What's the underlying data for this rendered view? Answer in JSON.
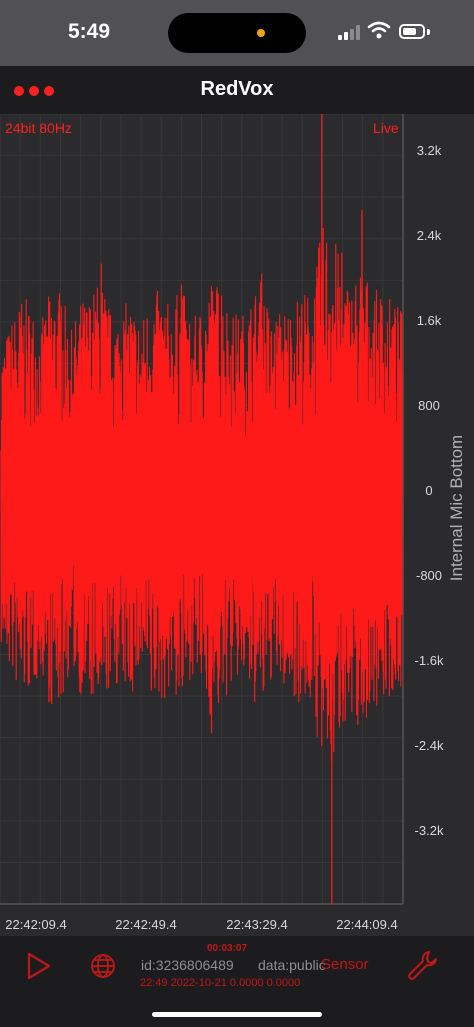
{
  "status_bar": {
    "time": "5:49"
  },
  "nav": {
    "title": "RedVox",
    "menu_icon": "more-dots-icon"
  },
  "plot": {
    "sample_info": "24bit 80Hz",
    "live_label": "Live",
    "y_axis_label": "Internal Mic Bottom",
    "y_ticks": [
      "3.2k",
      "2.4k",
      "1.6k",
      "800",
      "0",
      "-800",
      "-1.6k",
      "-2.4k",
      "-3.2k"
    ],
    "x_ticks": [
      "22:42:09.4",
      "22:42:49.4",
      "22:43:29.4",
      "22:44:09.4"
    ],
    "color": "#ff1a1a"
  },
  "chart_data": {
    "type": "line",
    "title": "",
    "xlabel": "",
    "ylabel": "Internal Mic Bottom",
    "x_range": [
      "22:42:09.4",
      "22:44:09.4"
    ],
    "ylim": [
      -3800,
      3600
    ],
    "grid": true,
    "series": [
      {
        "values": [
          120,
          -900,
          1600,
          -1400,
          800,
          -1900,
          1800,
          -600,
          1500,
          -1700,
          2200,
          -1100,
          1300,
          -1500,
          900,
          -1800,
          1700,
          -1300,
          2000,
          -800,
          1400,
          -2200,
          1900,
          -1200,
          1100,
          -1600,
          2100,
          -1000,
          1300,
          -1400,
          1800,
          -1700,
          3600,
          -3800,
          2300,
          -2000,
          2700,
          -1700,
          1800,
          -1500,
          1200
        ]
      }
    ]
  },
  "toolbar": {
    "timer": "00:03:07",
    "station_id": "id:3236806489",
    "data_public": "data:public",
    "sensor_label": "Sensor",
    "footer": "22:49 2022-10-21 0.0000 0.0000",
    "play_icon": "play-icon",
    "globe_icon": "globe-icon",
    "wrench_icon": "wrench-icon"
  }
}
